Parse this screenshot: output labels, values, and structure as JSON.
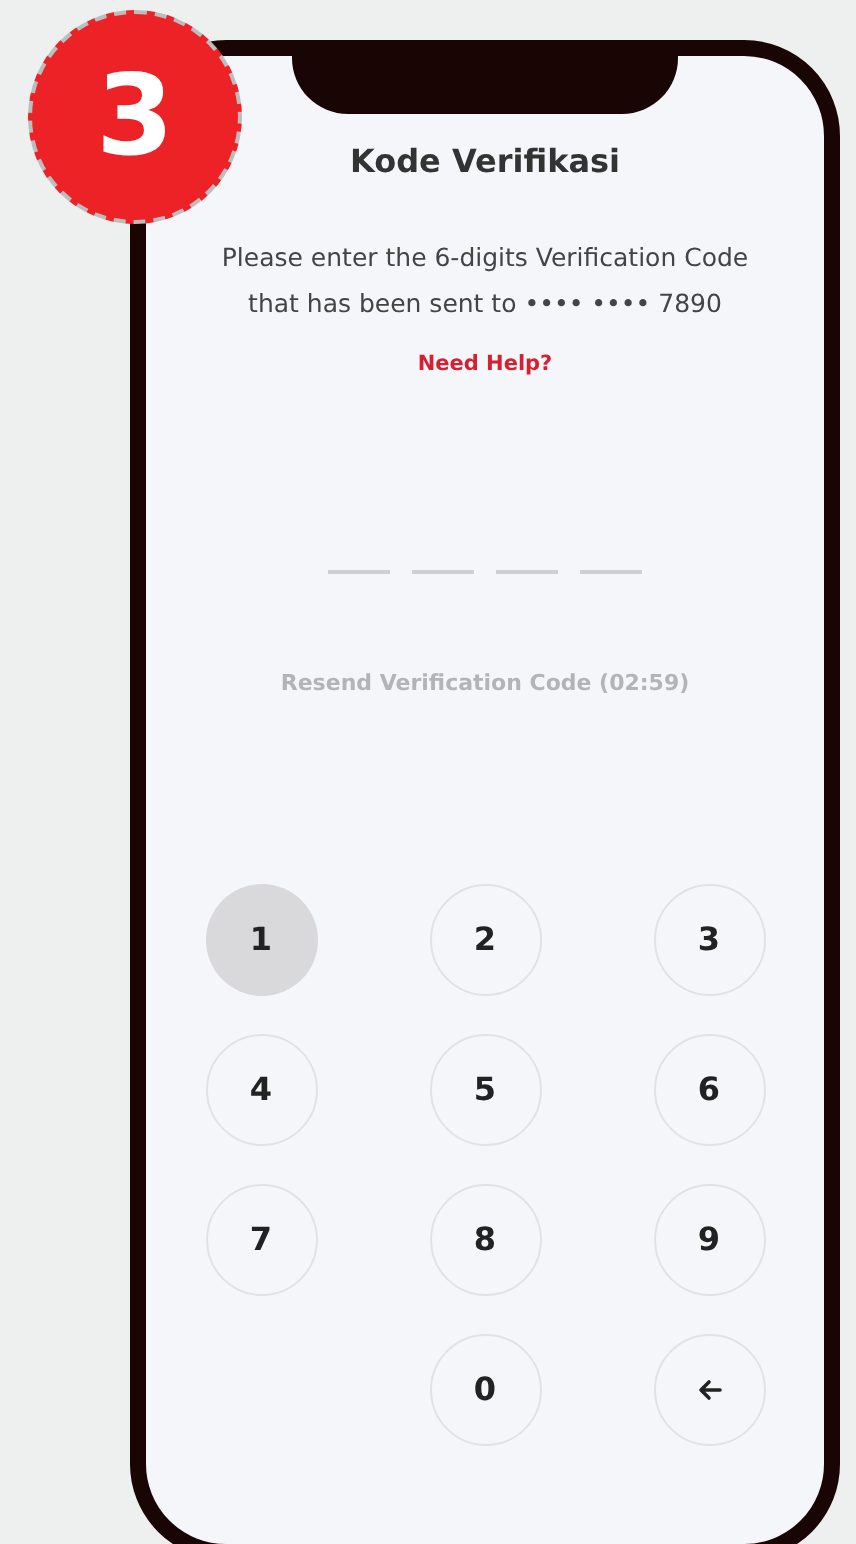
{
  "step_badge": "3",
  "title": "Kode Verifikasi",
  "instructions": [
    "Please enter the 6-digits Verification Code",
    "that has been sent to •••• •••• 7890"
  ],
  "help_link": "Need Help?",
  "code_slots": [
    {
      "filled": false
    },
    {
      "filled": false
    },
    {
      "filled": false
    },
    {
      "filled": false
    }
  ],
  "resend": {
    "label": "Resend Verification Code (02:59)",
    "disabled": true
  },
  "keypad": [
    {
      "kind": "digit",
      "label": "1",
      "selected": true
    },
    {
      "kind": "digit",
      "label": "2",
      "selected": false
    },
    {
      "kind": "digit",
      "label": "3",
      "selected": false
    },
    {
      "kind": "digit",
      "label": "4",
      "selected": false
    },
    {
      "kind": "digit",
      "label": "5",
      "selected": false
    },
    {
      "kind": "digit",
      "label": "6",
      "selected": false
    },
    {
      "kind": "digit",
      "label": "7",
      "selected": false
    },
    {
      "kind": "digit",
      "label": "8",
      "selected": false
    },
    {
      "kind": "digit",
      "label": "9",
      "selected": false
    },
    {
      "kind": "blank"
    },
    {
      "kind": "digit",
      "label": "0",
      "selected": false
    },
    {
      "kind": "backspace",
      "selected": false
    }
  ]
}
